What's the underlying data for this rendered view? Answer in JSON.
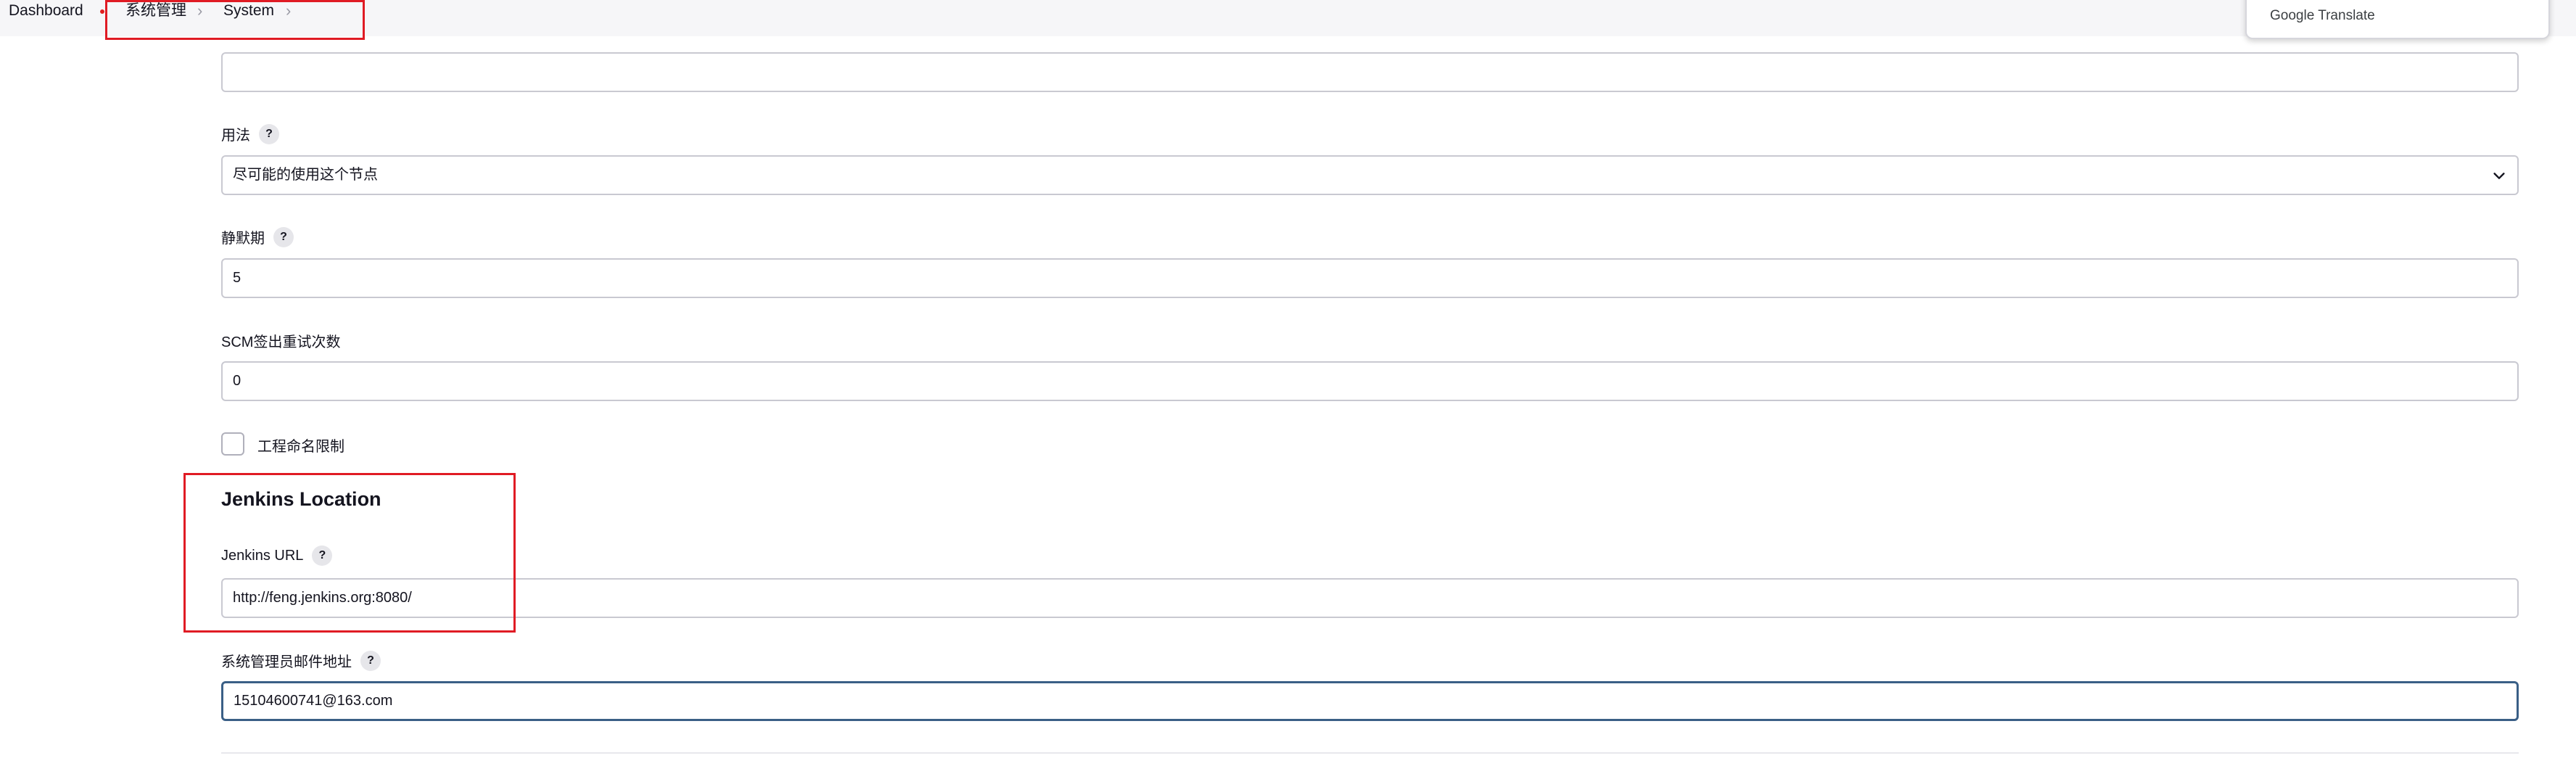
{
  "breadcrumb": {
    "items": [
      {
        "label": "Dashboard"
      },
      {
        "label": "系统管理"
      },
      {
        "label": "System"
      }
    ],
    "separator": "›"
  },
  "google_translate": {
    "label": "Google Translate"
  },
  "form": {
    "top_field_value": "",
    "usage": {
      "label": "用法",
      "help": "?",
      "selected": "尽可能的使用这个节点"
    },
    "quiet_period": {
      "label": "静默期",
      "help": "?",
      "value": "5"
    },
    "scm_retry": {
      "label": "SCM签出重试次数",
      "value": "0"
    },
    "project_naming": {
      "label": "工程命名限制",
      "checked": false
    }
  },
  "jenkins_location": {
    "title": "Jenkins Location",
    "url": {
      "label": "Jenkins URL",
      "help": "?",
      "value": "http://feng.jenkins.org:8080/"
    },
    "admin_email": {
      "label": "系统管理员邮件地址",
      "help": "?",
      "value": "15104600741@163.com"
    }
  },
  "colors": {
    "annotation_red": "#e01b24",
    "focus_border": "#3a5f86",
    "input_border": "#c9c9d1"
  },
  "icons": {
    "help": "question-mark-circle",
    "select": "chevron-down",
    "separator": "chevron-right"
  }
}
